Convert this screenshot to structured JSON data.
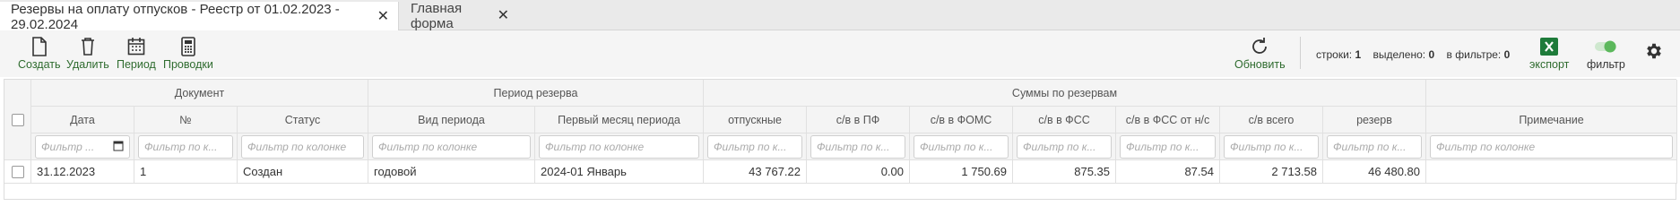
{
  "tabs": [
    {
      "label": "Резервы на оплату отпусков - Реестр от 01.02.2023 - 29.02.2024"
    },
    {
      "label": "Главная форма"
    }
  ],
  "toolbar": {
    "create": "Создать",
    "delete": "Удалить",
    "period": "Период",
    "postings": "Проводки",
    "refresh": "Обновить",
    "export": "экспорт",
    "filter": "фильтр"
  },
  "counters": {
    "rows_label": "строки:",
    "rows_value": "1",
    "selected_label": "выделено:",
    "selected_value": "0",
    "infilter_label": "в фильтре:",
    "infilter_value": "0"
  },
  "grid": {
    "groups": {
      "document": "Документ",
      "period": "Период резерва",
      "sums": "Суммы по резервам"
    },
    "columns": {
      "date": "Дата",
      "number": "№",
      "status": "Статус",
      "period_kind": "Вид периода",
      "first_month": "Первый месяц периода",
      "vacation": "отпускные",
      "pf": "с/в в ПФ",
      "foms": "с/в в ФОМС",
      "fss": "с/в в ФСС",
      "fss_ns": "с/в в ФСС от н/с",
      "total": "с/в всего",
      "reserve": "резерв",
      "note": "Примечание"
    },
    "filter_placeholders": {
      "date": "Фильтр ...",
      "short": "Фильтр по к...",
      "long": "Фильтр по колонке"
    },
    "row": {
      "date": "31.12.2023",
      "number": "1",
      "status": "Создан",
      "period_kind": "годовой",
      "first_month": "2024-01 Январь",
      "vacation": "43 767.22",
      "pf": "0.00",
      "foms": "1 750.69",
      "fss": "875.35",
      "fss_ns": "87.54",
      "total": "2 713.58",
      "reserve": "46 480.80",
      "note": ""
    }
  },
  "colors": {
    "accent_green": "#2e6b2e",
    "excel_green": "#1e7b3a",
    "toggle_green": "#5cb85c"
  }
}
